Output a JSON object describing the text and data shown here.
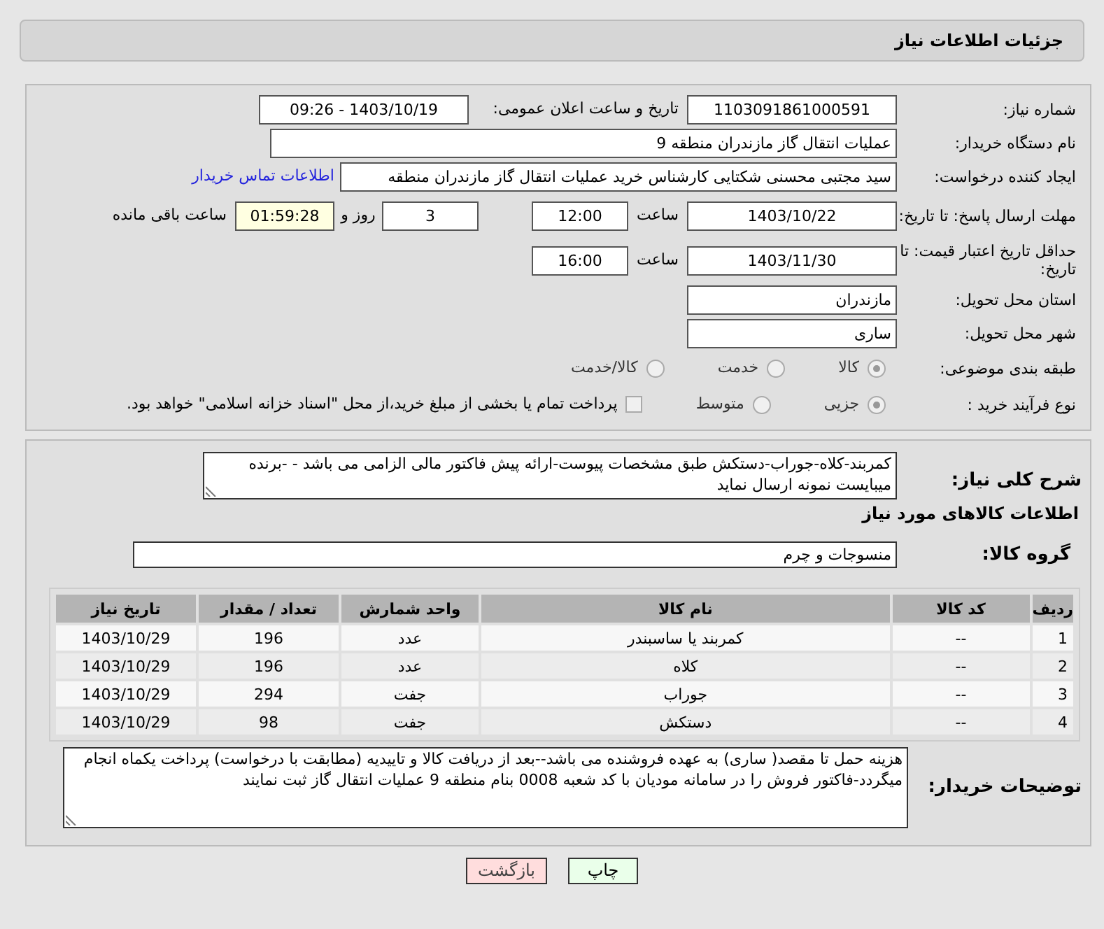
{
  "page_title": "جزئیات اطلاعات نیاز",
  "need_number": {
    "label": "شماره نیاز:",
    "value": "1103091861000591"
  },
  "announce_datetime": {
    "label": "تاریخ و ساعت اعلان عمومی:",
    "value": "1403/10/19 - 09:26"
  },
  "buyer_org": {
    "label": "نام دستگاه خریدار:",
    "value": "عملیات انتقال گاز مازندران منطقه 9"
  },
  "requester": {
    "label": "ایجاد کننده درخواست:",
    "value": "سید مجتبی محسنی شکتایی کارشناس خرید عملیات انتقال گاز مازندران منطقه",
    "link": "اطلاعات تماس خریدار"
  },
  "reply_deadline": {
    "label": "مهلت ارسال پاسخ: تا تاریخ:",
    "date": "1403/10/22",
    "time_label": "ساعت",
    "time": "12:00",
    "days": "3",
    "days_label": "روز و",
    "remaining": "01:59:28",
    "remaining_label": "ساعت باقی مانده"
  },
  "price_validity": {
    "label": "حداقل تاریخ اعتبار قیمت: تا تاریخ:",
    "date": "1403/11/30",
    "time_label": "ساعت",
    "time": "16:00"
  },
  "province": {
    "label": "استان محل تحویل:",
    "value": "مازندران"
  },
  "city": {
    "label": "شهر محل تحویل:",
    "value": "ساری"
  },
  "category": {
    "label": "طبقه بندی موضوعی:",
    "options": [
      {
        "label": "کالا",
        "selected": true
      },
      {
        "label": "خدمت",
        "selected": false
      },
      {
        "label": "کالا/خدمت",
        "selected": false
      }
    ]
  },
  "process": {
    "label": "نوع فرآیند خرید :",
    "options": [
      {
        "label": "جزیی",
        "selected": true
      },
      {
        "label": "متوسط",
        "selected": false
      }
    ],
    "payment_note": {
      "label": "پرداخت تمام یا بخشی از مبلغ خرید،از محل \"اسناد خزانه اسلامی\" خواهد بود.",
      "checked": false
    }
  },
  "description": {
    "label": "شرح کلی نیاز:",
    "value": "کمربند-کلاه-جوراب-دستکش طبق مشخصات پیوست-ارائه پیش فاکتور مالی الزامی می باشد - -برنده میبایست نمونه ارسال نماید"
  },
  "goods_title": "اطلاعات کالاهای مورد نیاز",
  "goods_group": {
    "label": "گروه کالا:",
    "value": "منسوجات و چرم"
  },
  "table": {
    "columns": [
      "ردیف",
      "کد کالا",
      "نام کالا",
      "واحد شمارش",
      "تعداد / مقدار",
      "تاریخ نیاز"
    ],
    "rows": [
      [
        "1",
        "--",
        "کمربند یا ساسبندر",
        "عدد",
        "196",
        "1403/10/29"
      ],
      [
        "2",
        "--",
        "کلاه",
        "عدد",
        "196",
        "1403/10/29"
      ],
      [
        "3",
        "--",
        "جوراب",
        "جفت",
        "294",
        "1403/10/29"
      ],
      [
        "4",
        "--",
        "دستکش",
        "جفت",
        "98",
        "1403/10/29"
      ]
    ]
  },
  "buyer_notes": {
    "label": "توضیحات خریدار:",
    "value": "هزینه حمل تا مقصد( ساری) به عهده فروشنده می باشد--بعد از دریافت کالا و تاییدیه (مطابقت با درخواست) پرداخت یکماه انجام میگردد-فاکتور فروش را در سامانه مودیان با کد شعبه 0008 بنام منطقه 9 عملیات انتقال گاز ثبت نمایند"
  },
  "buttons": [
    {
      "label": "چاپ",
      "kind": "print"
    },
    {
      "label": "بازگشت",
      "kind": "back"
    }
  ]
}
